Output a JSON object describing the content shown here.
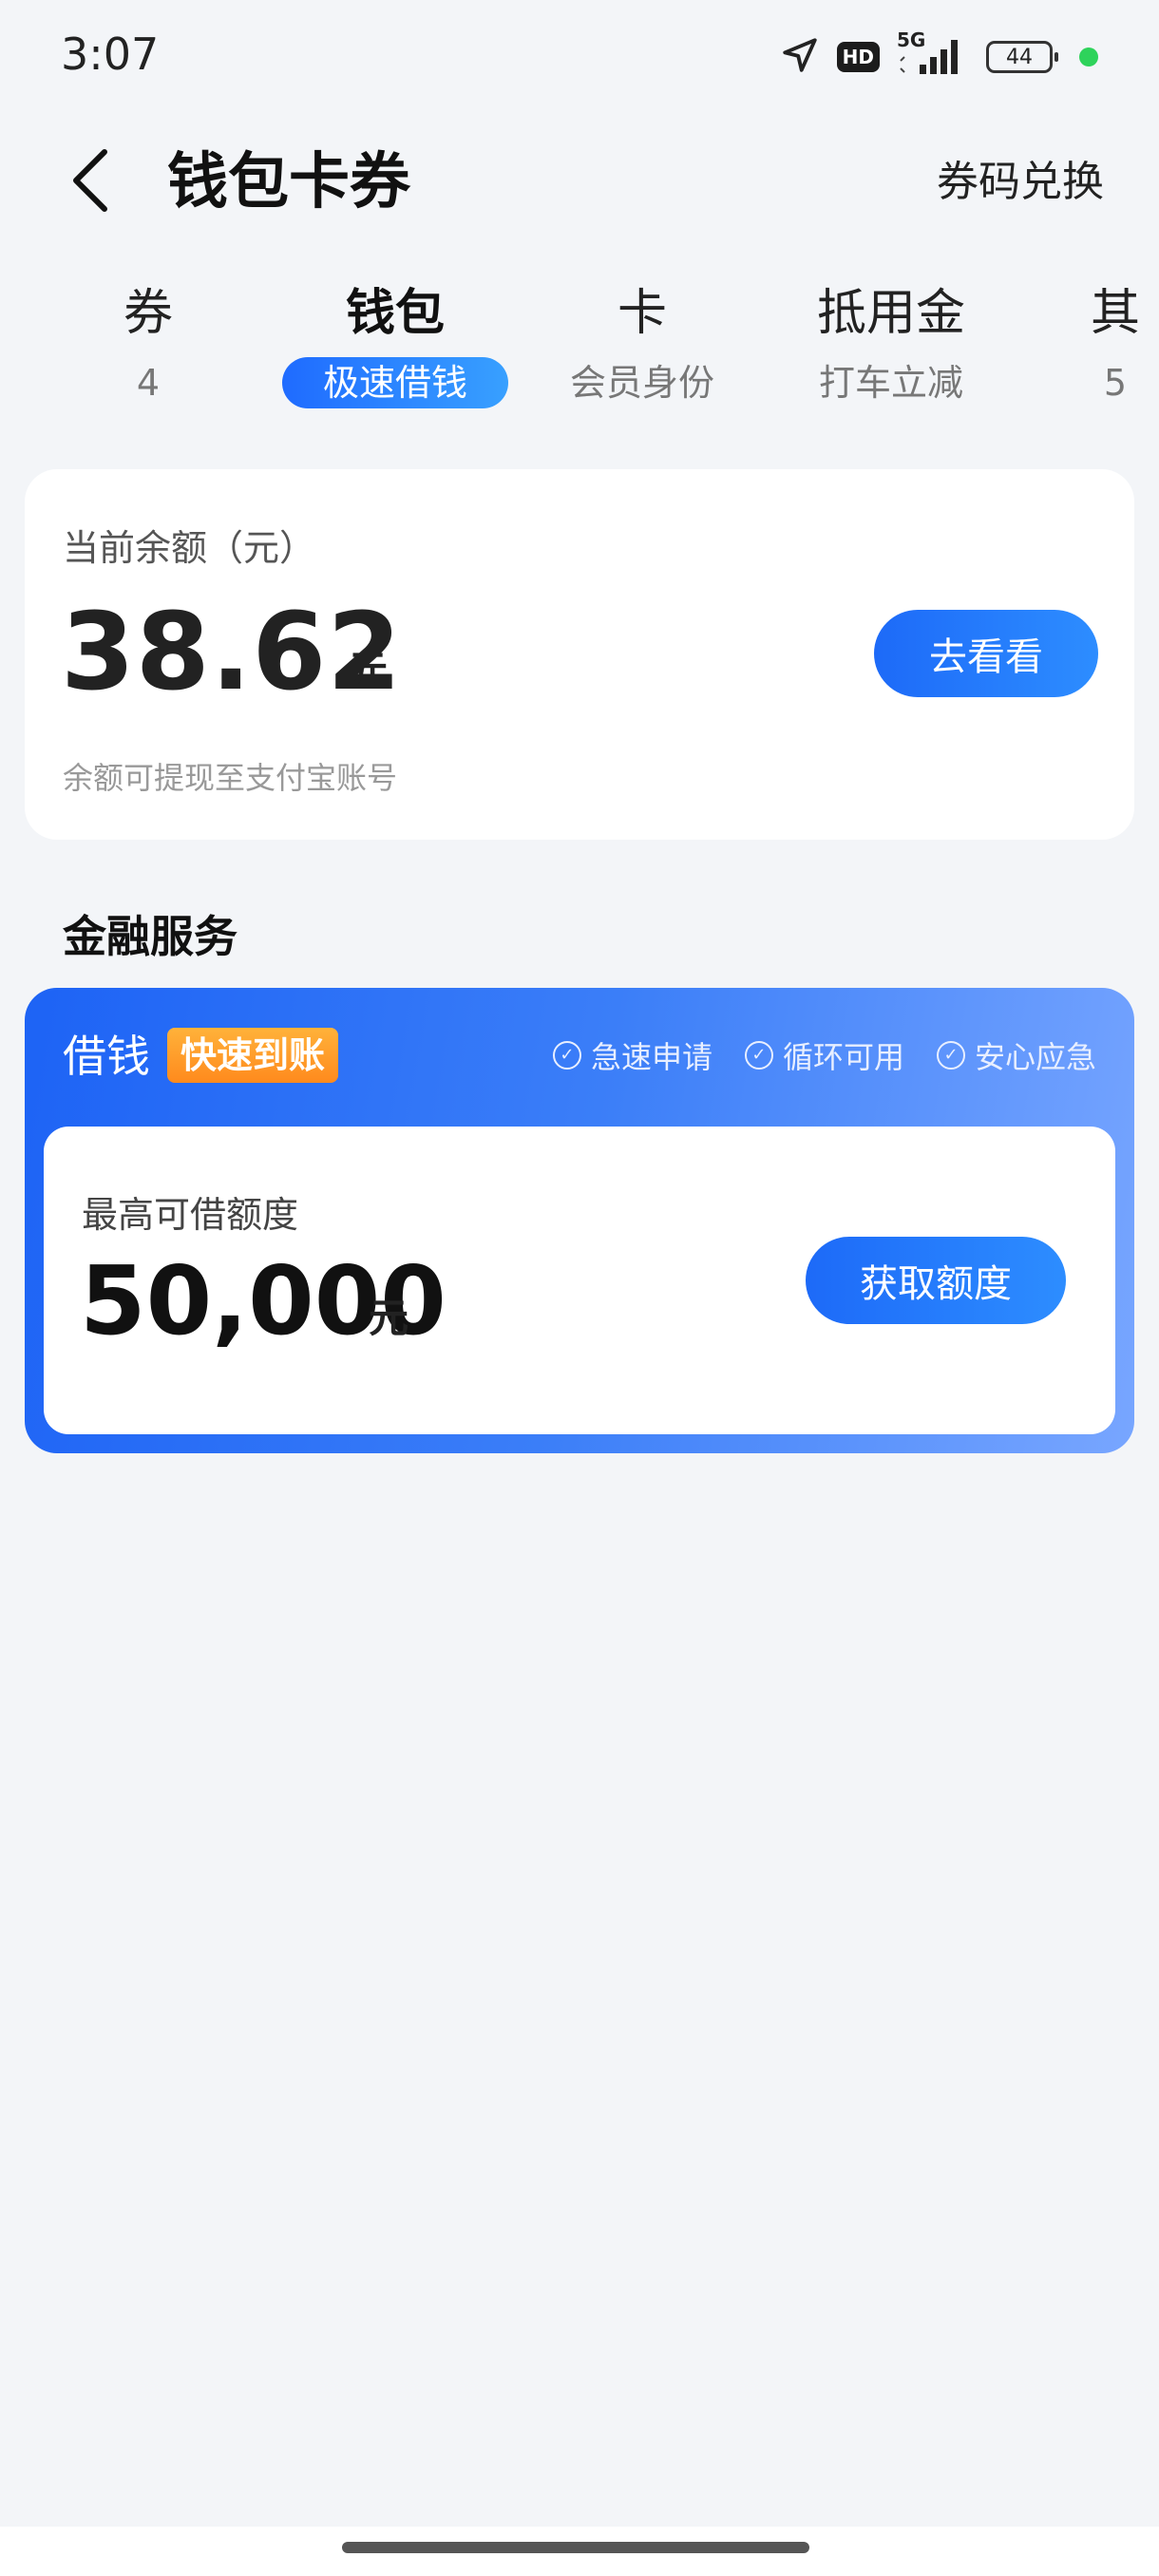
{
  "status_bar": {
    "time": "3:07",
    "hd": "HD",
    "network": "5G",
    "battery": "44"
  },
  "header": {
    "title": "钱包卡券",
    "redeem": "券码兑换"
  },
  "tabs": [
    {
      "label": "券",
      "sub": "4"
    },
    {
      "label": "钱包",
      "sub": "极速借钱"
    },
    {
      "label": "卡",
      "sub": "会员身份"
    },
    {
      "label": "抵用金",
      "sub": "打车立减"
    },
    {
      "label": "其",
      "sub": "5"
    }
  ],
  "balance": {
    "label": "当前余额（元）",
    "amount": "38.62",
    "unit": "元",
    "note": "余额可提现至支付宝账号",
    "button": "去看看"
  },
  "finance": {
    "section_title": "金融服务",
    "loan_title": "借钱",
    "badge": "快速到账",
    "features": [
      "急速申请",
      "循环可用",
      "安心应急"
    ],
    "limit_label": "最高可借额度",
    "limit_amount": "50,000",
    "unit": "元",
    "button": "获取额度"
  },
  "colors": {
    "accent": "#1d6af8",
    "badge": "#ff9a2a",
    "background": "#f3f5f8"
  }
}
